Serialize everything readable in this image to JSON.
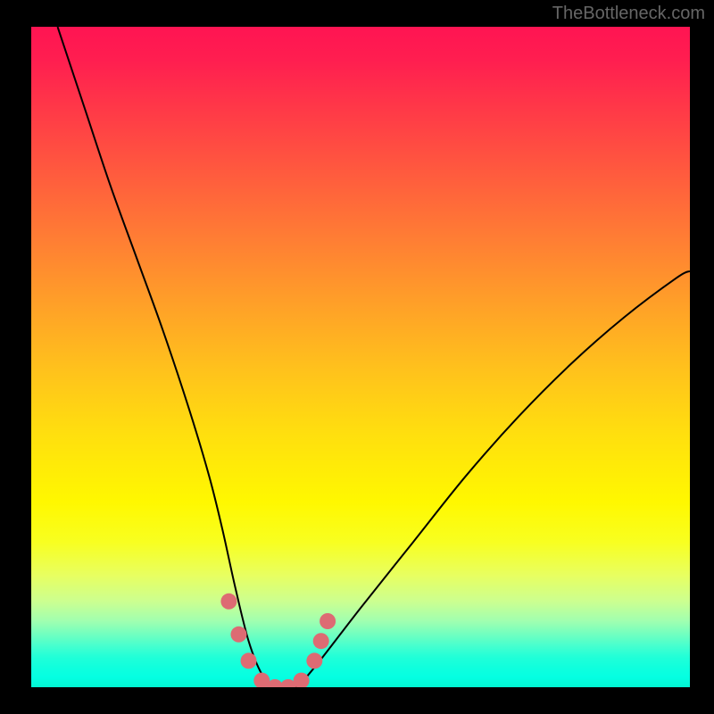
{
  "watermark": "TheBottleneck.com",
  "chart_data": {
    "type": "line",
    "title": "",
    "xlabel": "",
    "ylabel": "",
    "xlim": [
      0,
      100
    ],
    "ylim": [
      0,
      100
    ],
    "grid": false,
    "series": [
      {
        "name": "bottleneck-curve",
        "x": [
          4,
          8,
          12,
          16,
          20,
          24,
          27,
          29,
          31,
          33,
          35,
          37,
          40,
          43,
          50,
          58,
          66,
          74,
          82,
          90,
          98,
          100
        ],
        "y": [
          100,
          88,
          76,
          65,
          54,
          42,
          32,
          24,
          15,
          7,
          2,
          0,
          0,
          3,
          12,
          22,
          32,
          41,
          49,
          56,
          62,
          63
        ]
      }
    ],
    "markers": {
      "name": "highlight-dots",
      "color": "#dd6b73",
      "points": [
        {
          "x": 30,
          "y": 13
        },
        {
          "x": 31.5,
          "y": 8
        },
        {
          "x": 33,
          "y": 4
        },
        {
          "x": 35,
          "y": 1
        },
        {
          "x": 37,
          "y": 0
        },
        {
          "x": 39,
          "y": 0
        },
        {
          "x": 41,
          "y": 1
        },
        {
          "x": 43,
          "y": 4
        },
        {
          "x": 44,
          "y": 7
        },
        {
          "x": 45,
          "y": 10
        }
      ]
    },
    "background_gradient": {
      "top": "#ff1452",
      "mid": "#fff800",
      "bottom": "#02f6d3"
    }
  }
}
